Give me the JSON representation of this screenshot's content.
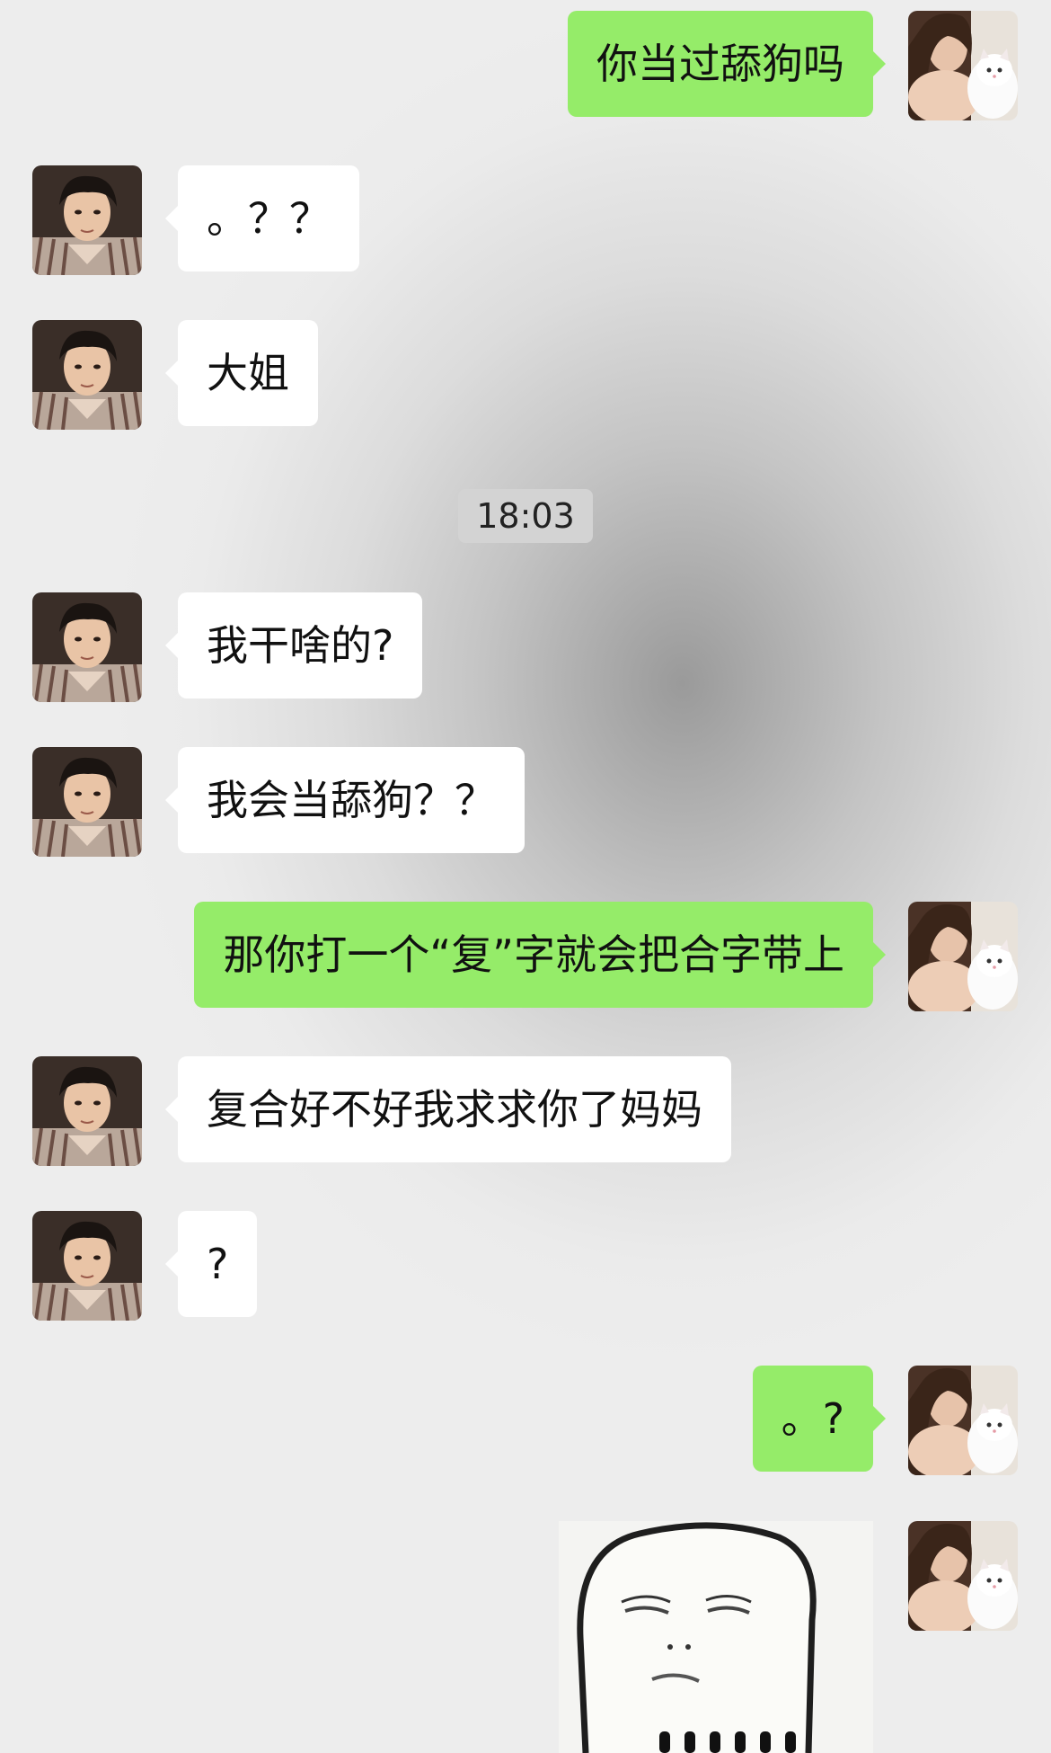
{
  "chat": {
    "timestamp": "18:03",
    "messages": [
      {
        "from": "me",
        "text": "你当过舔狗吗"
      },
      {
        "from": "them",
        "text": "。？？"
      },
      {
        "from": "them",
        "text": "大姐"
      },
      {
        "from": "them",
        "text": "我干啥的?"
      },
      {
        "from": "them",
        "text": "我会当舔狗？？"
      },
      {
        "from": "me",
        "text": "那你打一个“复”字就会把合字带上"
      },
      {
        "from": "them",
        "text": "复合好不好我求求你了妈妈"
      },
      {
        "from": "them",
        "text": "?"
      },
      {
        "from": "me",
        "text": "。?"
      },
      {
        "from": "me",
        "type": "sticker",
        "sticker": "blank-face-meme-sticker"
      }
    ]
  },
  "colors": {
    "outgoing_bubble": "#95ec69",
    "incoming_bubble": "#ffffff",
    "timestamp_bg": "#d3d3d3"
  },
  "avatars": {
    "me": "woman-with-white-cat-avatar",
    "them": "man-striped-shirt-avatar"
  }
}
